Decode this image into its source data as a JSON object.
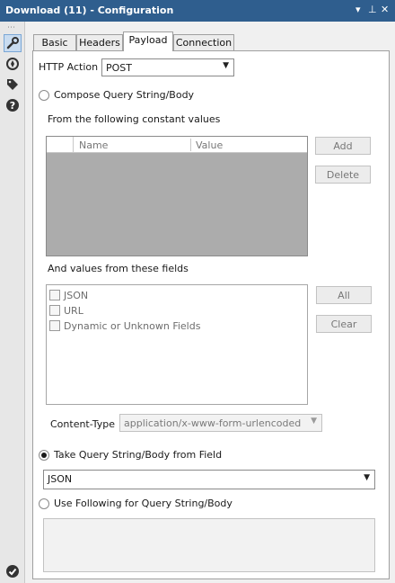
{
  "window": {
    "title": "Download (11) - Configuration"
  },
  "titlebar_controls": [
    "▾",
    "⊥",
    "✕"
  ],
  "sidebar": {
    "grip": "⋯",
    "tools": [
      "configuration-icon",
      "navigate-icon",
      "tag-icon",
      "help-icon"
    ],
    "bottom": "check-icon"
  },
  "tabs": [
    {
      "label": "Basic",
      "active": false
    },
    {
      "label": "Headers",
      "active": false
    },
    {
      "label": "Payload",
      "active": true
    },
    {
      "label": "Connection",
      "active": false
    }
  ],
  "http_action": {
    "label": "HTTP Action",
    "value": "POST"
  },
  "compose": {
    "label": "Compose Query String/Body",
    "constants_label": "From the following constant values",
    "grid_columns": [
      "Name",
      "Value"
    ],
    "add_label": "Add",
    "delete_label": "Delete",
    "fields_label": "And values from these fields",
    "fields": [
      "JSON",
      "URL",
      "Dynamic or Unknown Fields"
    ],
    "all_label": "All",
    "clear_label": "Clear",
    "content_type_label": "Content-Type",
    "content_type_value": "application/x-www-form-urlencoded"
  },
  "take_from_field": {
    "label": "Take Query String/Body from Field",
    "value": "JSON",
    "checked": true
  },
  "use_following": {
    "label": "Use Following for Query String/Body",
    "value": ""
  },
  "colors": {
    "titlebar": "#2f5e8e",
    "active_tool": "#c9dcf0"
  }
}
